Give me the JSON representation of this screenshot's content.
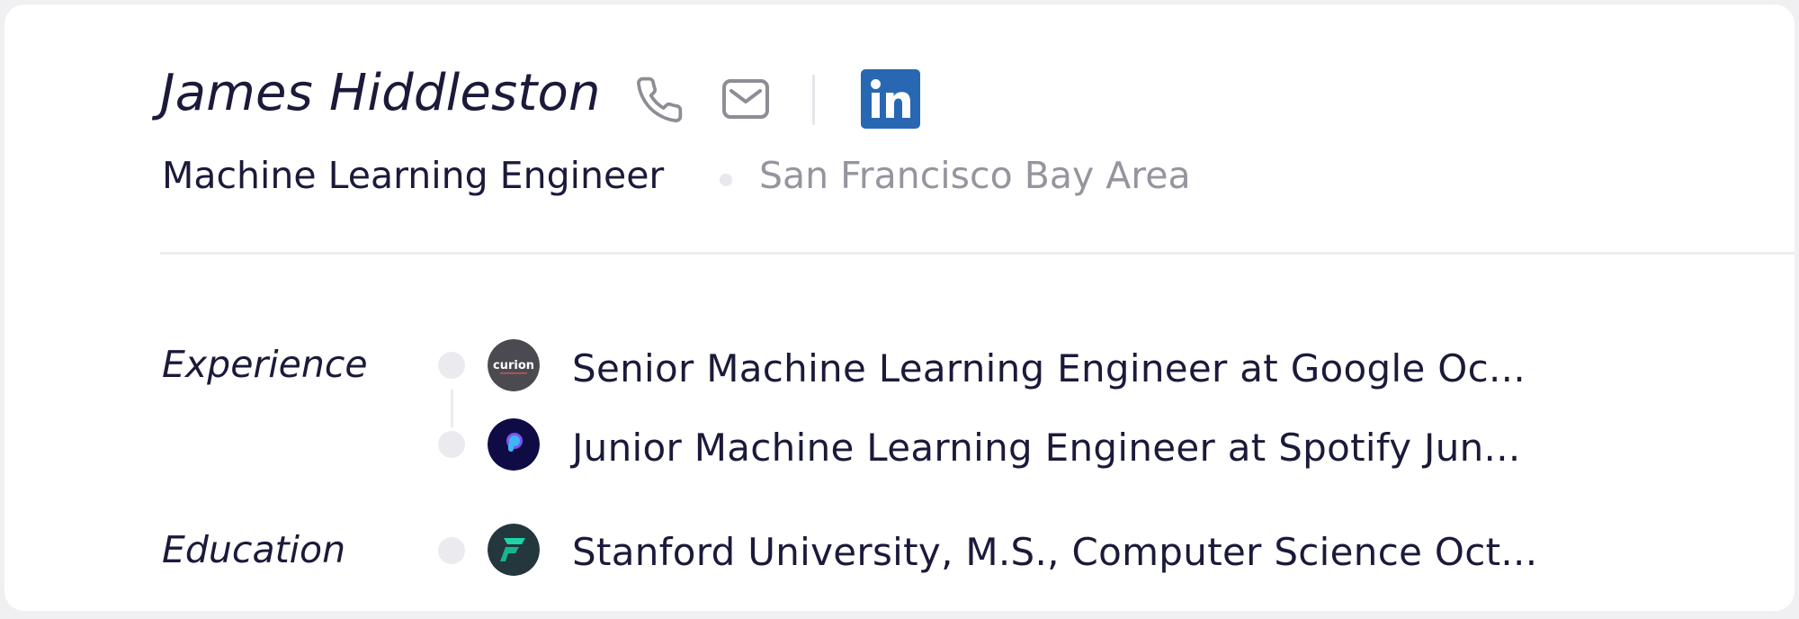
{
  "profile": {
    "name": "James Hiddleston",
    "title": "Machine Learning Engineer",
    "location": "San Francisco Bay Area"
  },
  "contact": {
    "icons": [
      "phone-icon",
      "mail-icon",
      "linkedin-icon"
    ],
    "linkedin_color": "#2867b2"
  },
  "sections": {
    "experience": {
      "label": "Experience",
      "items": [
        {
          "text": "Senior Machine Learning Engineer at Google Oc...",
          "logo": "curion-logo",
          "logo_text": "curion"
        },
        {
          "text": "Junior Machine Learning Engineer at Spotify Jun...",
          "logo": "spotify-logo"
        }
      ]
    },
    "education": {
      "label": "Education",
      "items": [
        {
          "text": "Stanford University, M.S., Computer Science Oct...",
          "logo": "stanford-logo"
        }
      ]
    }
  },
  "colors": {
    "text_primary": "#1b1a3a",
    "text_secondary": "#95959f",
    "divider": "#ededf0"
  }
}
